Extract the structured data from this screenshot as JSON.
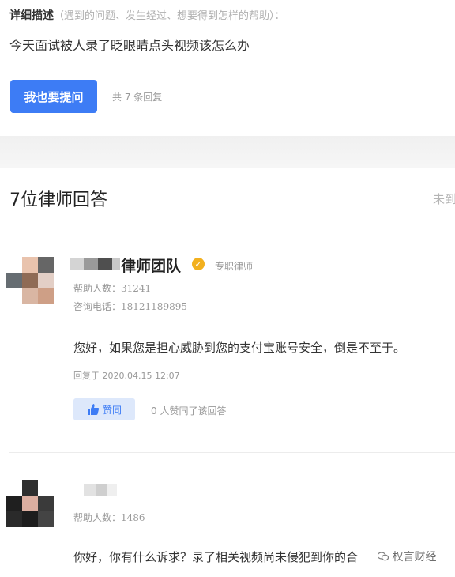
{
  "question": {
    "detail_label": "详细描述",
    "detail_hint": "（遇到的问题、发生经过、想要得到怎样的帮助）：",
    "text": "今天面试被人录了眨眼睛点头视频该怎么办",
    "ask_button": "我也要提问",
    "reply_count": "共 7 条回复"
  },
  "answers_header": {
    "title": "7位律师回答",
    "right_label": "未到"
  },
  "answers": [
    {
      "name_suffix": "律师团队",
      "tag": "专职律师",
      "helped": "帮助人数：31241",
      "phone": "咨询电话：18121189895",
      "text": "您好，如果您是担心威胁到您的支付宝账号安全，倒是不至于。",
      "reply_time": "回复于 2020.04.15 12:07",
      "like_label": "赞同",
      "like_count": "0 人赞同了该回答"
    },
    {
      "helped": "帮助人数：1486",
      "text": "你好，你有什么诉求？录了相关视频尚未侵犯到你的合"
    }
  ],
  "watermark": "权言财经",
  "icons": {
    "verified": "verified-check-icon",
    "thumb": "thumbs-up-icon",
    "watermark": "wechat-icon"
  },
  "colors": {
    "accent": "#3d7cf5",
    "verified": "#f2b01e"
  }
}
